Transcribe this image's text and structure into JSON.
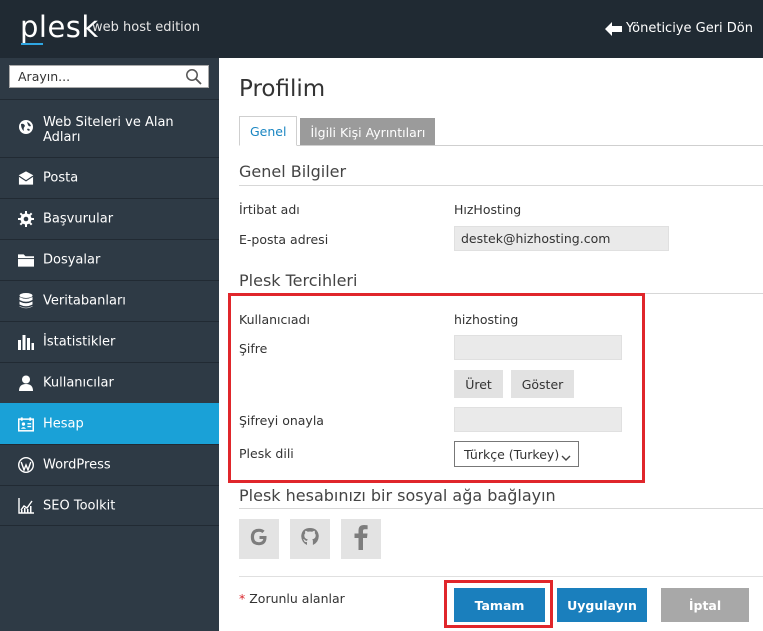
{
  "header": {
    "logo": "plesk",
    "edition": "web host edition",
    "back_label": "Yöneticiye Geri Dön"
  },
  "sidebar": {
    "search_placeholder": "Arayın...",
    "items": [
      {
        "label": "Web Siteleri ve Alan Adları",
        "icon": "globe-icon"
      },
      {
        "label": "Posta",
        "icon": "mail-icon"
      },
      {
        "label": "Başvurular",
        "icon": "gear-icon"
      },
      {
        "label": "Dosyalar",
        "icon": "folder-icon"
      },
      {
        "label": "Veritabanları",
        "icon": "database-icon"
      },
      {
        "label": "İstatistikler",
        "icon": "bar-chart-icon"
      },
      {
        "label": "Kullanıcılar",
        "icon": "user-icon"
      },
      {
        "label": "Hesap",
        "icon": "account-card-icon",
        "active": true
      },
      {
        "label": "WordPress",
        "icon": "wordpress-icon"
      },
      {
        "label": "SEO Toolkit",
        "icon": "seo-chart-icon"
      }
    ],
    "active_color": "#1aa1d7"
  },
  "main": {
    "title": "Profilim",
    "tabs": [
      {
        "label": "Genel",
        "active": true
      },
      {
        "label": "İlgili Kişi Ayrıntıları",
        "active": false
      }
    ],
    "general": {
      "title": "Genel Bilgiler",
      "contact_name_label": "İrtibat adı",
      "contact_name_value": "HızHosting",
      "email_label": "E-posta adresi",
      "email_value": "destek@hizhosting.com"
    },
    "prefs": {
      "title": "Plesk Tercihleri",
      "username_label": "Kullanıcıadı",
      "username_value": "hizhosting",
      "password_label": "Şifre",
      "password_value": "",
      "generate_label": "Üret",
      "show_label": "Göster",
      "confirm_label": "Şifreyi onayla",
      "confirm_value": "",
      "language_label": "Plesk dili",
      "language_value": "Türkçe (Turkey)"
    },
    "social": {
      "title": "Plesk hesabınızı bir sosyal ağa bağlayın",
      "providers": [
        "google-icon",
        "github-icon",
        "facebook-icon"
      ]
    },
    "footer": {
      "required_star": "*",
      "required_text": "Zorunlu alanlar",
      "ok_label": "Tamam",
      "apply_label": "Uygulayın",
      "cancel_label": "İptal"
    }
  },
  "colors": {
    "header_bg": "#202a33",
    "sidebar_bg": "#2e3a45",
    "primary_button": "#1a7fbd",
    "highlight": "#e0262b"
  }
}
